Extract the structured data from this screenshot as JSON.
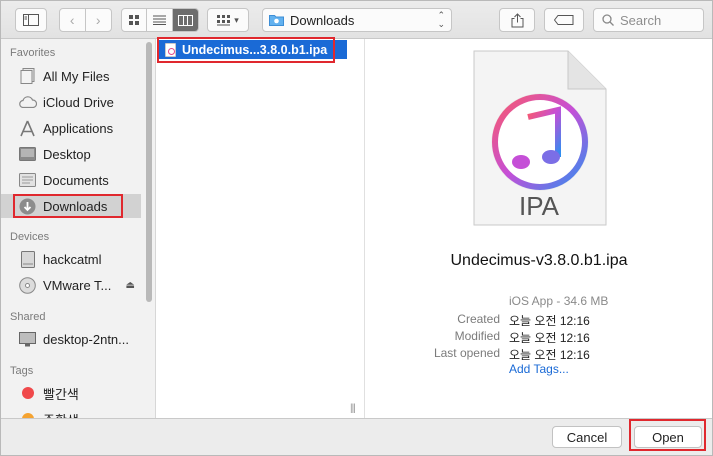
{
  "toolbar": {
    "path_label": "Downloads",
    "search_placeholder": "Search"
  },
  "sidebar": {
    "favorites_title": "Favorites",
    "favorites": [
      {
        "label": "All My Files",
        "icon": "all-files-icon"
      },
      {
        "label": "iCloud Drive",
        "icon": "cloud-icon"
      },
      {
        "label": "Applications",
        "icon": "applications-icon"
      },
      {
        "label": "Desktop",
        "icon": "desktop-icon"
      },
      {
        "label": "Documents",
        "icon": "documents-icon"
      },
      {
        "label": "Downloads",
        "icon": "downloads-icon"
      }
    ],
    "devices_title": "Devices",
    "devices": [
      {
        "label": "hackcatml",
        "icon": "drive-icon"
      },
      {
        "label": "VMware T...",
        "icon": "disc-icon"
      }
    ],
    "shared_title": "Shared",
    "shared": [
      {
        "label": "desktop-2ntn...",
        "icon": "monitor-icon"
      }
    ],
    "tags_title": "Tags",
    "tags": [
      {
        "label": "빨간색",
        "color": "#f0494b"
      },
      {
        "label": "주황색",
        "color": "#f5a331"
      }
    ]
  },
  "column": {
    "selected_file": "Undecimus...3.8.0.b1.ipa"
  },
  "preview": {
    "icon_text": "IPA",
    "file_name": "Undecimus-v3.8.0.b1.ipa",
    "kind_size": "iOS App - 34.6 MB",
    "created_label": "Created",
    "created_value": "오늘 오전 12:16",
    "modified_label": "Modified",
    "modified_value": "오늘 오전 12:16",
    "last_opened_label": "Last opened",
    "last_opened_value": "오늘 오전 12:16",
    "add_tags": "Add Tags..."
  },
  "buttons": {
    "cancel": "Cancel",
    "open": "Open"
  },
  "colors": {
    "selection": "#1a6ad6",
    "highlight_annotation": "#e0282e"
  }
}
